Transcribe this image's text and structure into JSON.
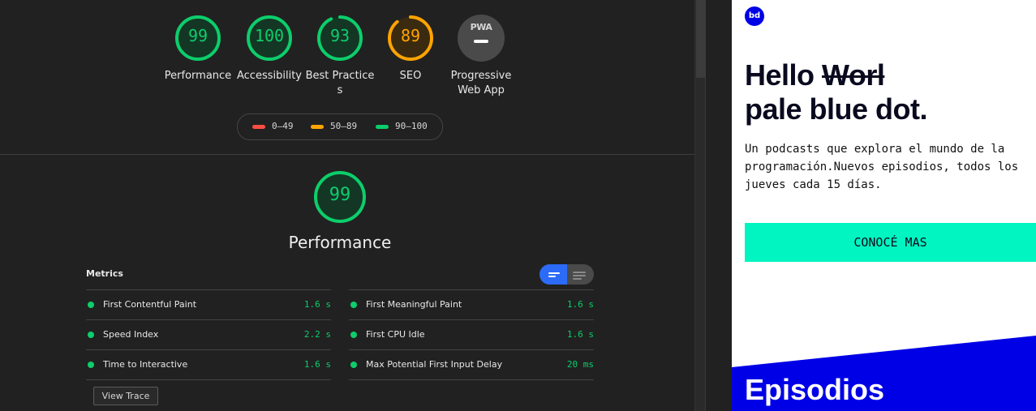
{
  "lighthouse": {
    "gauges": [
      {
        "score": "99",
        "label": "Performance",
        "color": "#0cce6b",
        "fill": 0.99
      },
      {
        "score": "100",
        "label": "Accessibility",
        "color": "#0cce6b",
        "fill": 1.0
      },
      {
        "score": "93",
        "label": "Best Practices",
        "color": "#0cce6b",
        "fill": 0.93
      },
      {
        "score": "89",
        "label": "SEO",
        "color": "#ffa400",
        "fill": 0.89
      }
    ],
    "pwa": {
      "badge": "PWA",
      "label": "Progressive Web App"
    },
    "legend": [
      {
        "range": "0–49",
        "color": "#ff4e42"
      },
      {
        "range": "50–89",
        "color": "#ffa400"
      },
      {
        "range": "90–100",
        "color": "#0cce6b"
      }
    ],
    "performance": {
      "score": "99",
      "title": "Performance",
      "fill": 0.99
    },
    "metrics_title": "Metrics",
    "metrics_left": [
      {
        "name": "First Contentful Paint",
        "value": "1.6 s"
      },
      {
        "name": "Speed Index",
        "value": "2.2 s"
      },
      {
        "name": "Time to Interactive",
        "value": "1.6 s"
      }
    ],
    "metrics_right": [
      {
        "name": "First Meaningful Paint",
        "value": "1.6 s"
      },
      {
        "name": "First CPU Idle",
        "value": "1.6 s"
      },
      {
        "name": "Max Potential First Input Delay",
        "value": "20 ms"
      }
    ],
    "view_trace": "View Trace"
  },
  "site": {
    "logo": "bd",
    "hero_hello": "Hello ",
    "hero_strike": "Worl",
    "hero_line2": "pale blue dot.",
    "blurb": "Un podcasts que explora el mundo de la programación.Nuevos episodios, todos los jueves cada 15 días.",
    "cta": "CONOCÉ MAS",
    "episodes": "Episodios",
    "brand_blue": "#0000e6",
    "accent": "#00f5c0"
  }
}
